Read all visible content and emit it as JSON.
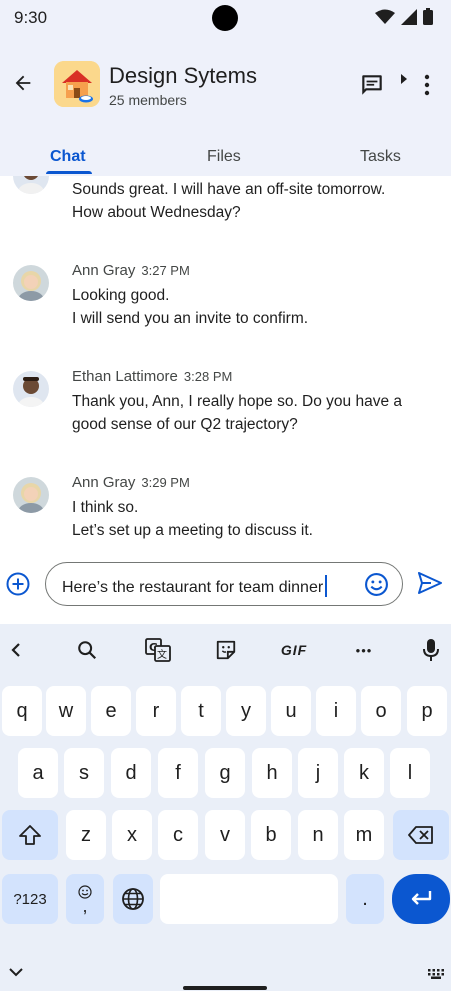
{
  "status": {
    "time": "9:30"
  },
  "header": {
    "title": "Design Sytems",
    "subtitle": "25 members"
  },
  "tabs": [
    {
      "label": "Chat",
      "active": true
    },
    {
      "label": "Files",
      "active": false
    },
    {
      "label": "Tasks",
      "active": false
    }
  ],
  "messages": [
    {
      "sender": "",
      "time": "",
      "lines": [
        "Sounds great. I will have an off-site tomorrow.",
        "How about Wednesday?"
      ]
    },
    {
      "sender": "Ann Gray",
      "time": "3:27 PM",
      "lines": [
        "Looking good.",
        "I will send you an invite to confirm."
      ]
    },
    {
      "sender": "Ethan Lattimore",
      "time": "3:28 PM",
      "lines": [
        "Thank you, Ann, I really hope so. Do you have a",
        "good sense of our Q2 trajectory?"
      ]
    },
    {
      "sender": "Ann Gray",
      "time": "3:29 PM",
      "lines": [
        "I think so.",
        "Let’s set up a meeting to discuss it."
      ]
    }
  ],
  "composer": {
    "value": "Here’s the restaurant for team dinner"
  },
  "keyboard": {
    "toolbar": {
      "gif": "GIF",
      "more": "•••"
    },
    "row1": [
      "q",
      "w",
      "e",
      "r",
      "t",
      "y",
      "u",
      "i",
      "o",
      "p"
    ],
    "row2": [
      "a",
      "s",
      "d",
      "f",
      "g",
      "h",
      "j",
      "k",
      "l"
    ],
    "row3": [
      "z",
      "x",
      "c",
      "v",
      "b",
      "n",
      "m"
    ],
    "symbols": "?123",
    "comma": ",",
    "period": "."
  },
  "colors": {
    "accent": "#0b57d0",
    "background": "#eef1fa",
    "keyboard": "#eaeff8"
  }
}
